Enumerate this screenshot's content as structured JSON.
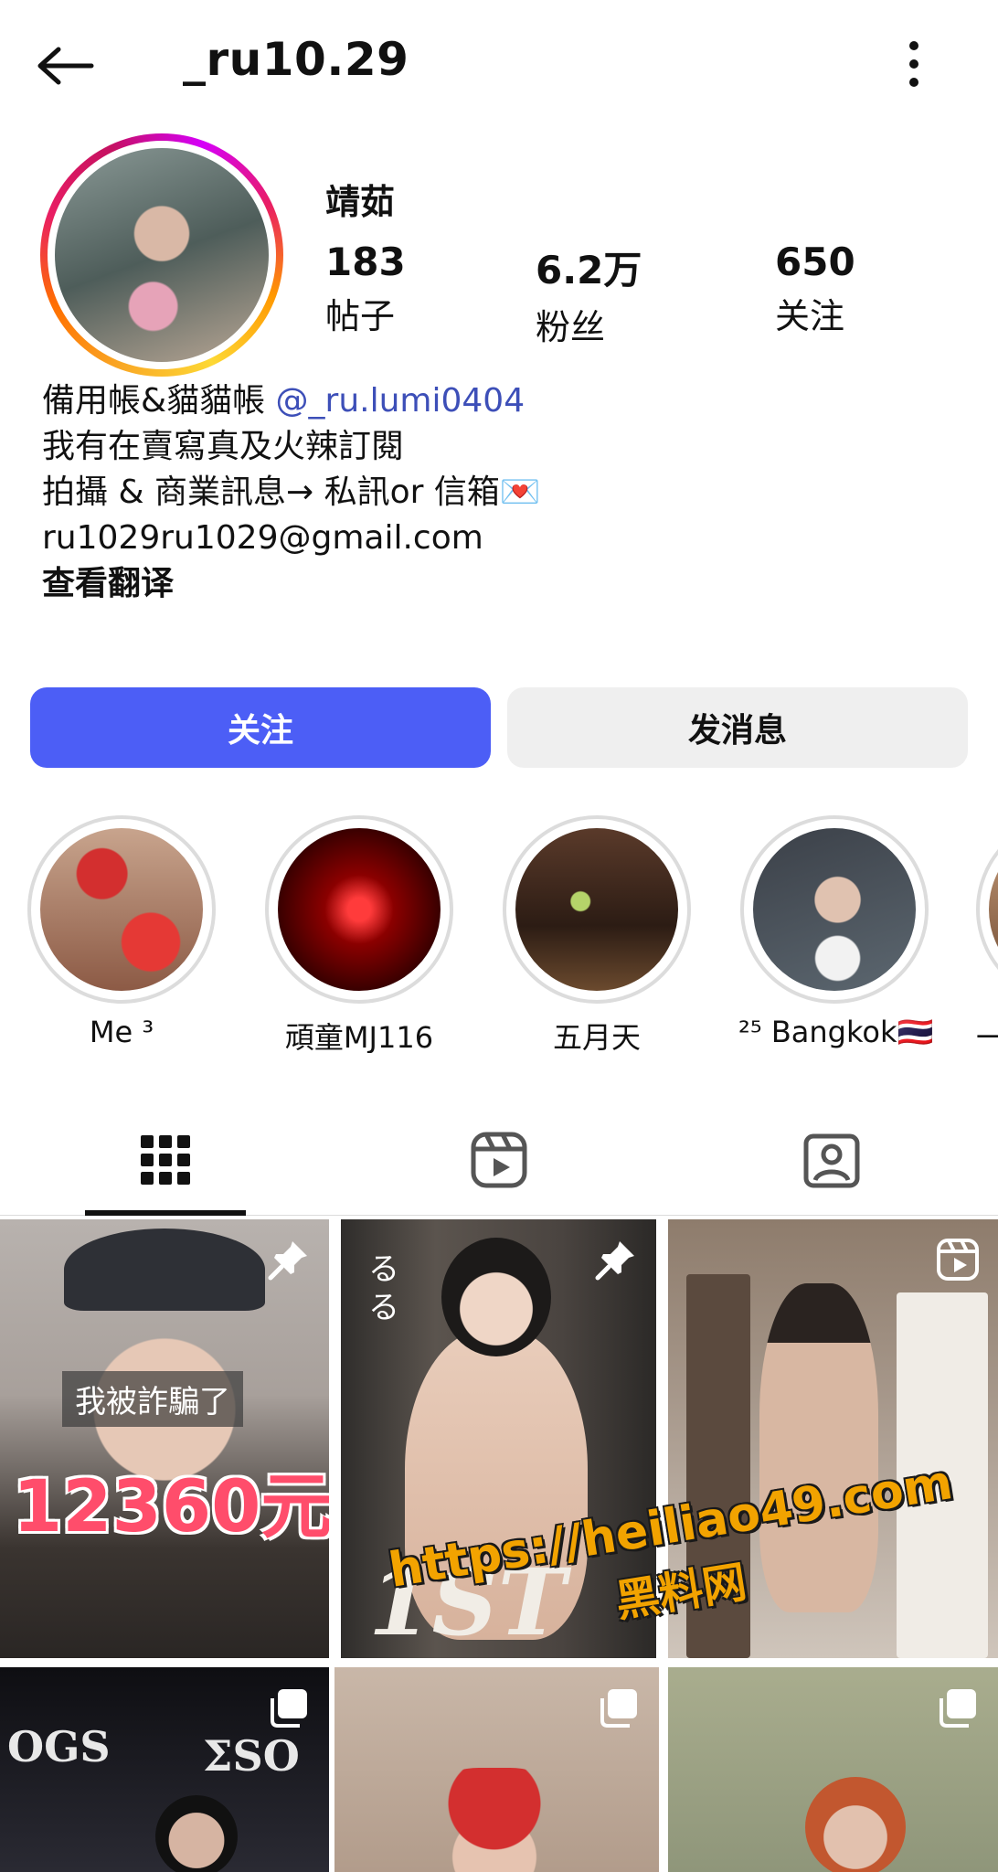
{
  "header": {
    "username": "_ru10.29"
  },
  "profile": {
    "display_name": "靖茹",
    "stats": [
      {
        "value": "183",
        "label": "帖子"
      },
      {
        "value": "6.2万",
        "label": "粉丝"
      },
      {
        "value": "650",
        "label": "关注"
      }
    ],
    "bio": {
      "line1_text": "備用帳&貓貓帳 ",
      "threads_handle": "@_ru.lumi0404",
      "line2": "我有在賣寫真及火辣訂閱",
      "line3": "拍攝 & 商業訊息→ 私訊or 信箱💌",
      "line4": "ru1029ru1029@gmail.com",
      "translate": "查看翻译"
    }
  },
  "actions": {
    "follow": "关注",
    "message": "发消息"
  },
  "highlights": [
    {
      "label": "Me ³"
    },
    {
      "label": "頑童MJ116"
    },
    {
      "label": "五月天"
    },
    {
      "label": "²⁵ Bangkok🇹🇭"
    },
    {
      "label": "一生"
    }
  ],
  "tabs": {
    "grid": "grid-icon",
    "reels": "reels-icon",
    "tagged": "tagged-icon",
    "active": "grid"
  },
  "posts": [
    {
      "overlay_title": "我被詐騙了",
      "overlay_price": "12360元",
      "badge": "pin-icon"
    },
    {
      "overlay_vert": "るる",
      "overlay_big": "1ST",
      "badge": "pin-icon"
    },
    {
      "badge": "reel-icon"
    },
    {
      "overlay_logo1": "OGS",
      "overlay_logo2": "ΣSO",
      "badge": "carousel-icon"
    },
    {
      "badge": "carousel-icon"
    },
    {
      "badge": "carousel-icon"
    }
  ],
  "watermark": {
    "url": "https://heiliao49.com",
    "name": "黑料网"
  },
  "colors": {
    "follow_button": "#4c5ef6",
    "message_button": "#efefef",
    "link": "#3d4fb8",
    "watermark": "#f2a300"
  }
}
